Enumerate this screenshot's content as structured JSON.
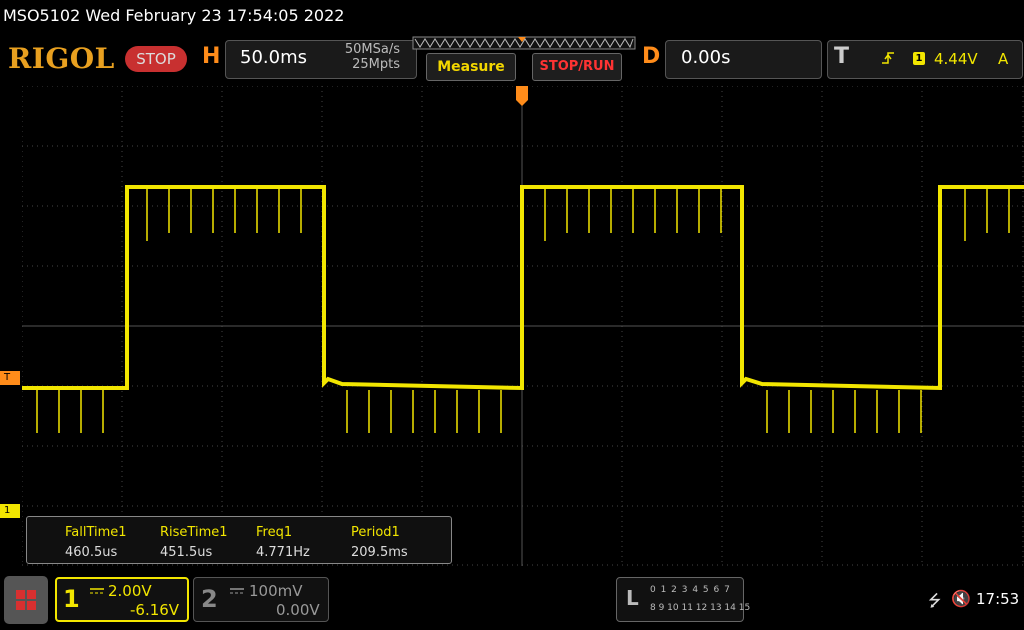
{
  "window": {
    "title": "MSO5102  Wed February 23 17:54:05 2022"
  },
  "brand": {
    "logo": "RIGOL",
    "state": "STOP"
  },
  "horizontal": {
    "letter": "H",
    "timebase": "50.0ms",
    "sample_rate": "50MSa/s",
    "memory_depth": "25Mpts"
  },
  "buttons": {
    "measure": "Measure",
    "stop_run": "STOP/RUN"
  },
  "delay": {
    "letter": "D",
    "value": "0.00s"
  },
  "trigger": {
    "letter": "T",
    "edge_icon": "rising-edge-icon",
    "source": "1",
    "level": "4.44V",
    "mode": "A"
  },
  "markers": {
    "trigger": "T",
    "channel1": "1"
  },
  "measurements": [
    {
      "name": "FallTime1",
      "value": "460.5us"
    },
    {
      "name": "RiseTime1",
      "value": "451.5us"
    },
    {
      "name": "Freq1",
      "value": "4.771Hz"
    },
    {
      "name": "Period1",
      "value": "209.5ms"
    }
  ],
  "channel1": {
    "number": "1",
    "coupling_icon": "dc-coupling-icon",
    "scale": "2.00V",
    "offset": "-6.16V",
    "color": "#f2e600"
  },
  "channel2": {
    "number": "2",
    "coupling_icon": "dc-coupling-icon",
    "scale": "100mV",
    "offset": "0.00V"
  },
  "logic": {
    "letter": "L",
    "row1": "0 1 2 3  4 5 6 7",
    "row2": "8 9 10 11 12 13 14 15"
  },
  "status": {
    "time": "17:53",
    "usb_icon": "usb-icon",
    "speaker_icon": "speaker-muted-icon"
  },
  "colors": {
    "accent": "#ff8c1a",
    "trace": "#f2e600",
    "stop": "#c83030"
  }
}
